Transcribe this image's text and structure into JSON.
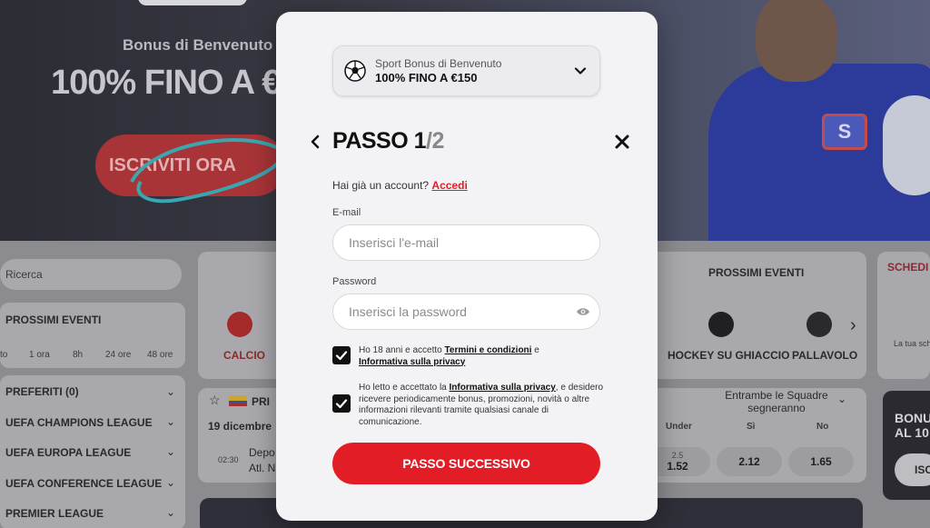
{
  "hero": {
    "subtitle": "Bonus di Benvenuto",
    "title": "100% FINO A €",
    "cta": "ISCRIVITI ORA",
    "badge": "S"
  },
  "background": {
    "search_placeholder": "Ricerca",
    "upcoming_title": "PROSSIMI EVENTI",
    "time_filters": [
      "to",
      "1 ora",
      "8h",
      "24 ore",
      "48 ore"
    ],
    "sidebar": {
      "favorites_label": "PREFERITI",
      "favorites_count": "(0)",
      "leagues": [
        "UEFA CHAMPIONS LEAGUE",
        "UEFA EUROPA LEAGUE",
        "UEFA CONFERENCE LEAGUE",
        "PREMIER LEAGUE"
      ]
    },
    "sports": [
      "CALCIO",
      "HOCKEY SU GHIACCIO",
      "PALLAVOLO"
    ],
    "center_header": "PROSSIMI EVENTI",
    "match": {
      "league_short": "PRI",
      "date": "19 dicembre",
      "time": "02:30",
      "team1": "Depo",
      "team2": "Atl. Na",
      "market": "Entrambe le Squadre segneranno",
      "columns": [
        "Under",
        "Sì",
        "No"
      ],
      "line": "2.5",
      "odds": [
        "1.52",
        "2.12",
        "1.65"
      ]
    },
    "right_panel": {
      "title": "SCHEDI",
      "note": "La tua sch",
      "card_text_1": "BONU",
      "card_text_2": "AL 10",
      "card_button": "ISC"
    }
  },
  "modal": {
    "bonus": {
      "subtitle": "Sport Bonus di Benvenuto",
      "title": "100% FINO A €150"
    },
    "step": {
      "prefix": "PASSO 1",
      "total": "/2"
    },
    "login_prompt": "Hai già un account?",
    "login_link": "Accedi",
    "email": {
      "label": "E-mail",
      "placeholder": "Inserisci l'e-mail",
      "value": ""
    },
    "password": {
      "label": "Password",
      "placeholder": "Inserisci la password",
      "value": ""
    },
    "consent1": {
      "checked": true,
      "text_a": "Ho 18 anni e accetto ",
      "link1": "Termini e condizioni",
      "text_b": " e ",
      "link2": "Informativa sulla privacy"
    },
    "consent2": {
      "checked": true,
      "text_a": "Ho letto e accettato la ",
      "link": "Informativa sulla privacy",
      "text_b": ", e desidero ricevere periodicamente bonus, promozioni, novità o altre informazioni rilevanti tramite qualsiasi canale di comunicazione."
    },
    "next_button": "PASSO SUCCESSIVO"
  },
  "colors": {
    "accent": "#e31d25",
    "modal_bg": "#f3f3f5",
    "overlay": "#8c8c90"
  },
  "icons": {
    "bonus": "soccer-ball-icon",
    "dropdown": "chevron-down-icon",
    "back": "chevron-left-icon",
    "close": "close-icon",
    "password_toggle": "eye-icon",
    "checkbox": "checkmark-icon"
  }
}
